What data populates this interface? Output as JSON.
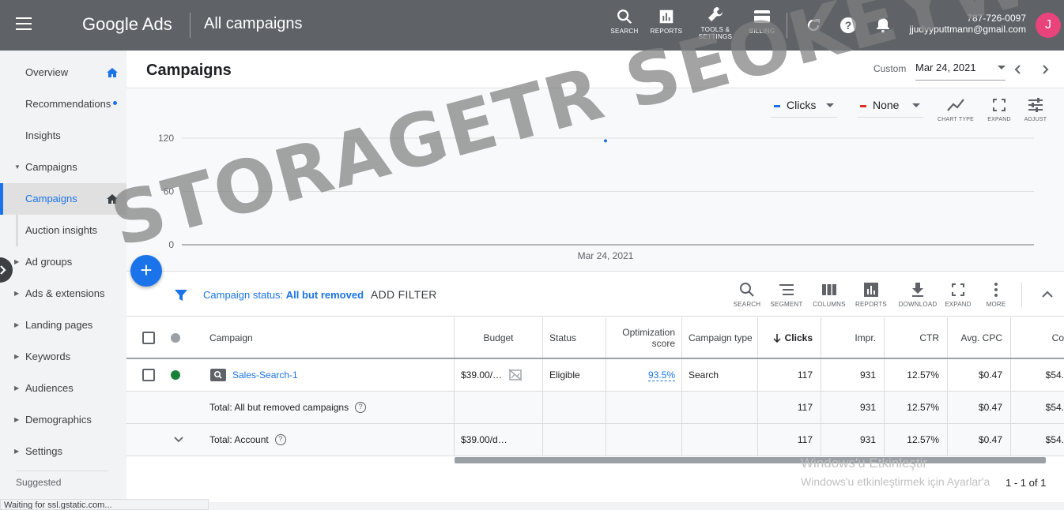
{
  "topbar": {
    "brand": "Google Ads",
    "page_name": "All campaigns",
    "tools": [
      {
        "label": "SEARCH",
        "icon": "search-icon"
      },
      {
        "label": "REPORTS",
        "icon": "reports-icon"
      },
      {
        "label": "TOOLS &\nSETTINGS",
        "icon": "wrench-icon"
      },
      {
        "label": "BILLING",
        "icon": "credit-card-icon"
      }
    ],
    "phone": "787-726-0097",
    "email": "jjudyyputtmann@gmail.com",
    "avatar_letter": "J"
  },
  "sidebar": {
    "items": [
      {
        "label": "Overview"
      },
      {
        "label": "Recommendations"
      },
      {
        "label": "Insights"
      },
      {
        "label": "Campaigns"
      },
      {
        "label": "Campaigns"
      },
      {
        "label": "Auction insights"
      },
      {
        "label": "Ad groups"
      },
      {
        "label": "Ads & extensions"
      },
      {
        "label": "Landing pages"
      },
      {
        "label": "Keywords"
      },
      {
        "label": "Audiences"
      },
      {
        "label": "Demographics"
      },
      {
        "label": "Settings"
      }
    ],
    "suggested": "Suggested"
  },
  "status_bar": "Waiting for ssl.gstatic.com...",
  "main": {
    "title": "Campaigns",
    "date_label": "Custom",
    "date_value": "Mar 24, 2021",
    "metric1": "Clicks",
    "metric2": "None",
    "chart_tools": [
      "CHART TYPE",
      "EXPAND",
      "ADJUST"
    ],
    "filter_prefix": "Campaign status: ",
    "filter_value": "All but removed",
    "add_filter": "ADD FILTER",
    "table_tools": [
      "SEARCH",
      "SEGMENT",
      "COLUMNS",
      "REPORTS",
      "DOWNLOAD",
      "EXPAND",
      "MORE"
    ]
  },
  "chart_data": {
    "type": "scatter",
    "x": [
      "Mar 24, 2021"
    ],
    "series": [
      {
        "values": [
          117
        ]
      }
    ],
    "yticks": [
      0,
      60,
      120
    ],
    "ylim": [
      0,
      120
    ],
    "xlabel": "",
    "ylabel": ""
  },
  "colors": {
    "series1": "#1a73e8",
    "series2": "#d93025",
    "eligible": "#188038"
  },
  "table": {
    "headers": {
      "campaign": "Campaign",
      "budget": "Budget",
      "status": "Status",
      "opt_score": "Optimization score",
      "campaign_type": "Campaign type",
      "clicks": "Clicks",
      "impr": "Impr.",
      "ctr": "CTR",
      "avg_cpc": "Avg. CPC",
      "cost": "Co"
    },
    "rows": [
      {
        "campaign": "Sales-Search-1",
        "budget": "$39.00/…",
        "status": "Eligible",
        "opt_score": "93.5%",
        "campaign_type": "Search",
        "clicks": "117",
        "impr": "931",
        "ctr": "12.57%",
        "avg_cpc": "$0.47",
        "cost": "$54."
      }
    ],
    "total_filtered": {
      "label": "Total: All but removed campaigns",
      "clicks": "117",
      "impr": "931",
      "ctr": "12.57%",
      "avg_cpc": "$0.47",
      "cost": "$54."
    },
    "total_account": {
      "label": "Total: Account",
      "budget": "$39.00/d…",
      "clicks": "117",
      "impr": "931",
      "ctr": "12.57%",
      "avg_cpc": "$0.47",
      "cost": "$54."
    }
  },
  "pagination": "1 - 1 of 1",
  "windows_activation": {
    "title": "Windows'u Etkinleştir",
    "subtitle": "Windows'u etkinleştirmek için Ayarlar'a"
  },
  "watermark": "STORAGETR SEOKEYWORD"
}
